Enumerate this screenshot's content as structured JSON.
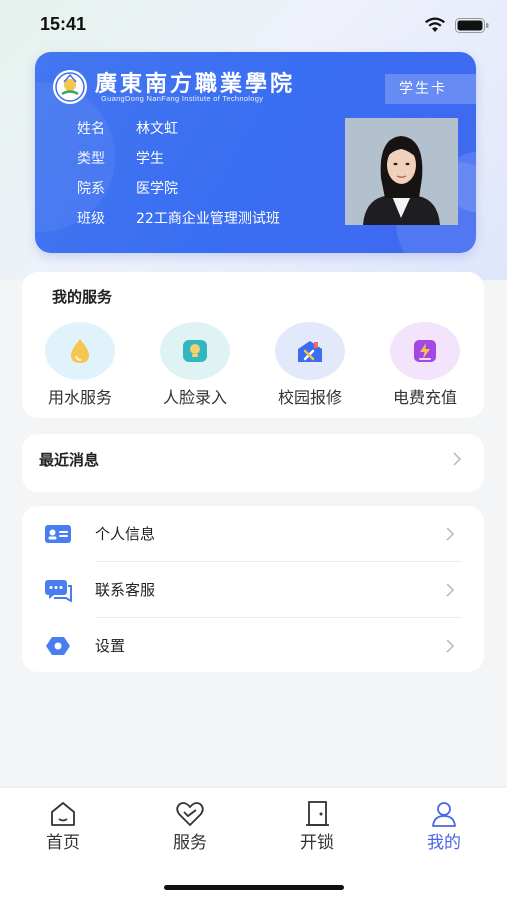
{
  "status_bar": {
    "time": "15:41"
  },
  "card": {
    "school_name": "廣東南方職業學院",
    "school_name_en": "GuangDong NanFang Institute of Technology",
    "badge": "学生卡",
    "fields": [
      {
        "label": "姓名",
        "value": "林文虹"
      },
      {
        "label": "类型",
        "value": "学生"
      },
      {
        "label": "院系",
        "value": "医学院"
      },
      {
        "label": "班级",
        "value": "22工商企业管理测试班"
      }
    ]
  },
  "services": {
    "title": "我的服务",
    "items": [
      {
        "label": "用水服务",
        "icon": "water-drop-icon",
        "color": "#5cc7e8"
      },
      {
        "label": "人脸录入",
        "icon": "face-entry-icon",
        "color": "#35b7c4"
      },
      {
        "label": "校园报修",
        "icon": "repair-icon",
        "color": "#3d6ff0"
      },
      {
        "label": "电费充值",
        "icon": "electric-recharge-icon",
        "color": "#a347e6"
      }
    ]
  },
  "recent": {
    "title": "最近消息"
  },
  "menu": {
    "items": [
      {
        "label": "个人信息",
        "icon": "id-card-icon"
      },
      {
        "label": "联系客服",
        "icon": "chat-icon"
      },
      {
        "label": "设置",
        "icon": "settings-icon"
      }
    ]
  },
  "tabbar": {
    "items": [
      {
        "label": "首页",
        "icon": "home-icon"
      },
      {
        "label": "服务",
        "icon": "heart-service-icon"
      },
      {
        "label": "开锁",
        "icon": "door-icon"
      },
      {
        "label": "我的",
        "icon": "user-icon"
      }
    ],
    "active": "我的",
    "accent": "#4a66e6"
  }
}
